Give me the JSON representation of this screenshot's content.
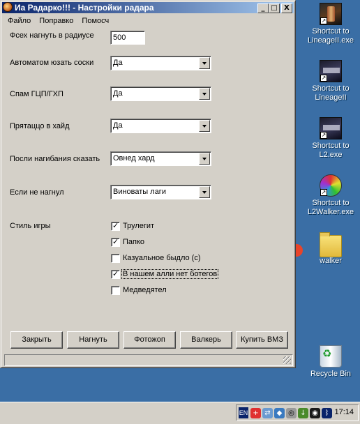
{
  "window": {
    "title": "Иа Радарко!!! - Настройки радара",
    "buttons": {
      "minimize": "_",
      "maximize": "□",
      "close": "X"
    }
  },
  "menu": [
    "Файло",
    "Поправко",
    "Помосч"
  ],
  "form": {
    "radius": {
      "label": "Фсех нагнуть в радиусе",
      "value": "500"
    },
    "auto_use": {
      "label": "Автоматом юзать соски",
      "value": "Да"
    },
    "spam": {
      "label": "Спам ГЦП/ГХП",
      "value": "Да"
    },
    "hide": {
      "label": "Прятаццо в хайд",
      "value": "Да"
    },
    "say_after": {
      "label": "Посли нагибания сказать",
      "value": "Овнед хард"
    },
    "if_failed": {
      "label": "Если не нагнул",
      "value": "Виноваты лаги"
    },
    "play_style": {
      "label": "Стиль игры",
      "options": [
        {
          "label": "Трулегит",
          "checked": true
        },
        {
          "label": "Папко",
          "checked": true
        },
        {
          "label": "Казуальное быдло (с)",
          "checked": false
        },
        {
          "label": "В нашем алли нет ботегов",
          "checked": true
        },
        {
          "label": "Медведятел",
          "checked": false
        }
      ]
    }
  },
  "buttons": [
    "Закрыть",
    "Нагнуть",
    "Фотожоп",
    "Валкерь",
    "Купить ВМЗ"
  ],
  "desktop_icons": [
    {
      "label": "Shortcut to LineageII.exe",
      "icon": "lineage-icon"
    },
    {
      "label": "Shortcut to LineageII",
      "icon": "lineage2-icon"
    },
    {
      "label": "Shortcut to L2.exe",
      "icon": "lineage2-icon"
    },
    {
      "label": "Shortcut to L2Walker.exe",
      "icon": "walker-icon"
    },
    {
      "label": "walker",
      "icon": "folder-icon"
    },
    {
      "label": "Recycle Bin",
      "icon": "recycle-bin-icon"
    }
  ],
  "taskbar": {
    "language": "EN",
    "clock": "17:14"
  },
  "colors": {
    "desktop": "#3a6ea5",
    "titlebar": "#0a246a",
    "face": "#d4d0c8"
  }
}
